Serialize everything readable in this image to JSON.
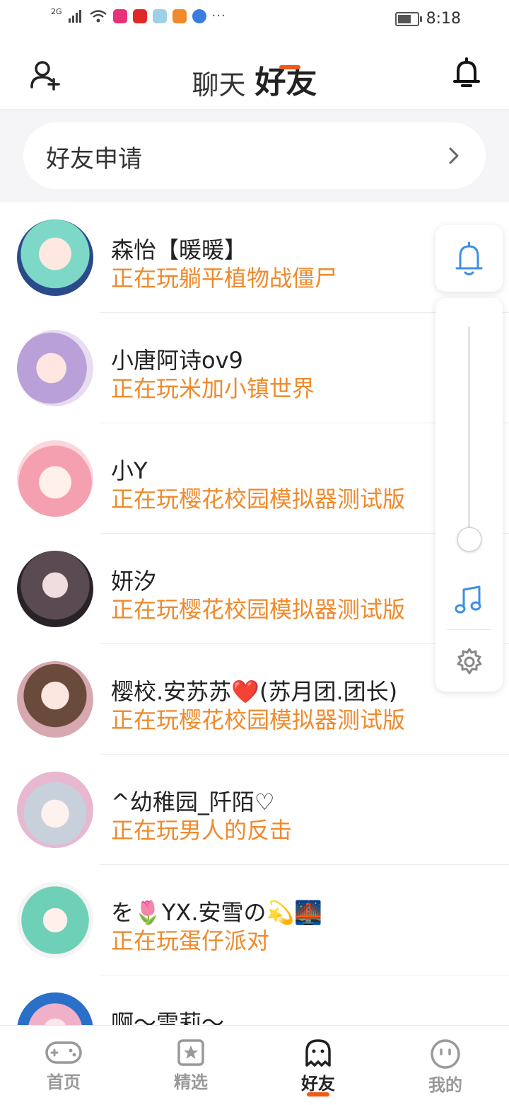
{
  "status_bar": {
    "network": "2G",
    "time": "8:18",
    "more": "···"
  },
  "header": {
    "tab_chat": "聊天",
    "tab_friends": "好友"
  },
  "friend_requests": {
    "label": "好友申请"
  },
  "friends": [
    {
      "name": "森怡【暖暖】",
      "status": "正在玩躺平植物战僵尸",
      "avatar_color": "#7ed8c8"
    },
    {
      "name": "小唐阿诗ov9",
      "status": "正在玩米加小镇世界",
      "avatar_color": "#b9a0d8"
    },
    {
      "name": "小Y",
      "status": "正在玩樱花校园模拟器测试版",
      "avatar_color": "#f4a0b0"
    },
    {
      "name": "妍汐",
      "status": "正在玩樱花校园模拟器测试版",
      "avatar_color": "#5a4a52"
    },
    {
      "name": "樱校.安苏苏❤️(苏月团.团长)",
      "status": "正在玩樱花校园模拟器测试版",
      "avatar_color": "#d8a8b0"
    },
    {
      "name": "^幼稚园_阡陌♡",
      "status": "正在玩男人的反击",
      "avatar_color": "#e8b8d0"
    },
    {
      "name": "を🌷YX.安雪の💫🌉",
      "status": "正在玩蛋仔派对",
      "avatar_color": "#6fd0b8"
    },
    {
      "name": "啊～雪莉～",
      "status": "",
      "avatar_color": "#2a6fc8"
    }
  ],
  "bottom_nav": [
    {
      "label": "首页",
      "icon": "gamepad-icon"
    },
    {
      "label": "精选",
      "icon": "featured-star-icon"
    },
    {
      "label": "好友",
      "icon": "ghost-icon"
    },
    {
      "label": "我的",
      "icon": "face-icon"
    }
  ],
  "colors": {
    "accent": "#ef5b16",
    "status_text": "#ef8a2c",
    "blue_icon": "#3d8fe6"
  }
}
